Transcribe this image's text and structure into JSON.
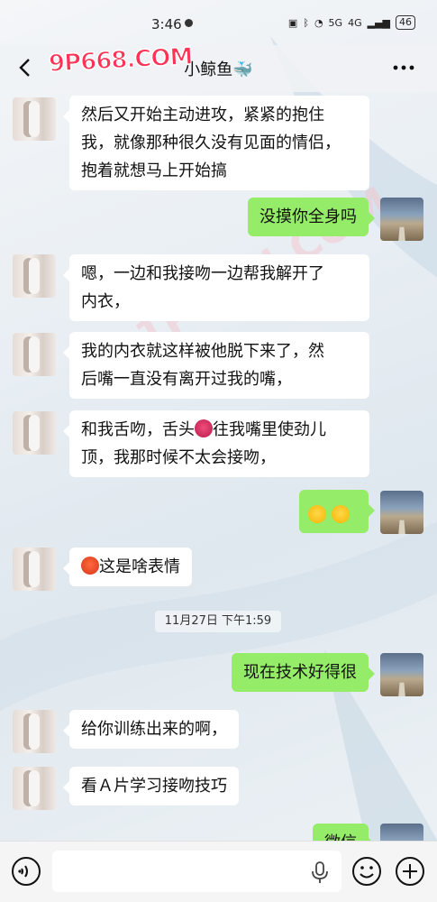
{
  "status_bar": {
    "time": "3:46",
    "network": "5G",
    "signal": "4G",
    "battery": "46"
  },
  "header": {
    "title": "小鲸鱼🐳",
    "logo_text": "9P668.COM"
  },
  "messages": [
    {
      "side": "left",
      "text_lines": [
        "然后又开始主动进攻，紧紧的抱住",
        "我，就像那种很久没有见面的情侣，",
        "抱着就想马上开始搞"
      ]
    },
    {
      "side": "right",
      "text": "没摸你全身吗"
    },
    {
      "side": "left",
      "text_lines": [
        "嗯，一边和我接吻一边帮我解开了",
        "内衣，"
      ]
    },
    {
      "side": "left",
      "text_lines": [
        "我的内衣就这样被他脱下来了，然",
        "后嘴一直没有离开过我的嘴，"
      ]
    },
    {
      "side": "left",
      "text_lines": [
        "和我舌吻，舌头",
        "往我嘴里使劲儿",
        "顶，我那时候不太会接吻，"
      ]
    },
    {
      "side": "right",
      "text": ""
    },
    {
      "side": "left",
      "text": "这是啥表情"
    },
    {
      "side": "right",
      "text": "现在技术好得很"
    },
    {
      "side": "left",
      "text": "给你训练出来的啊，"
    },
    {
      "side": "left",
      "text": "看Ａ片学习接吻技巧"
    },
    {
      "side": "right",
      "text": "微信"
    }
  ],
  "timestamp": "11月27日 下午1:59",
  "colors": {
    "bubble_right": "#95ec69",
    "bubble_left": "#ffffff",
    "logo": "#ff3355"
  }
}
